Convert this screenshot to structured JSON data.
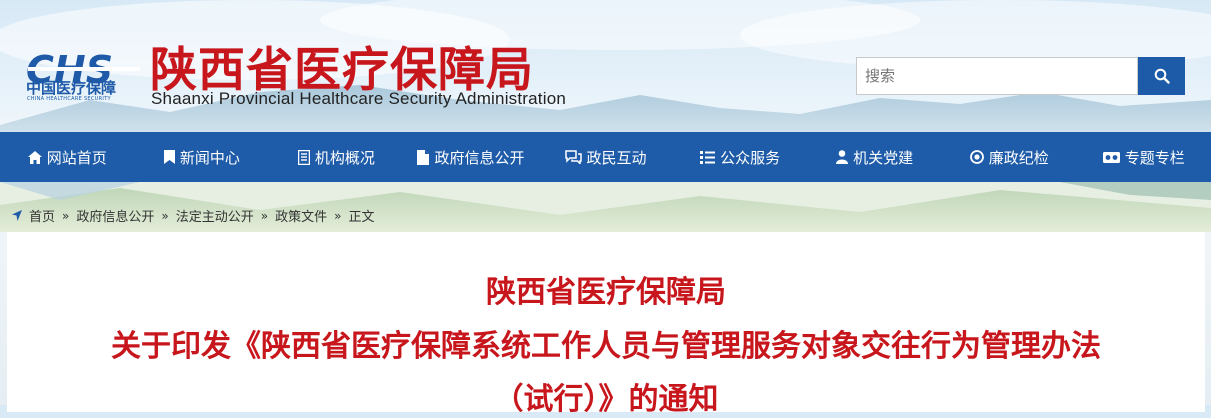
{
  "header": {
    "logo_cn": "中国医疗保障",
    "logo_en": "CHINA HEALTHCARE SECURITY",
    "site_title": "陕西省医疗保障局",
    "site_subtitle": "Shaanxi Provincial Healthcare Security Administration",
    "search_placeholder": "搜索"
  },
  "nav": {
    "items": [
      {
        "label": "网站首页",
        "icon": "home-icon"
      },
      {
        "label": "新闻中心",
        "icon": "bookmark-icon"
      },
      {
        "label": "机构概况",
        "icon": "book-icon"
      },
      {
        "label": "政府信息公开",
        "icon": "file-icon"
      },
      {
        "label": "政民互动",
        "icon": "chat-icon"
      },
      {
        "label": "公众服务",
        "icon": "list-icon"
      },
      {
        "label": "机关党建",
        "icon": "user-icon"
      },
      {
        "label": "廉政纪检",
        "icon": "target-icon"
      },
      {
        "label": "专题专栏",
        "icon": "columns-icon"
      }
    ]
  },
  "breadcrumb": {
    "items": [
      "首页",
      "政府信息公开",
      "法定主动公开",
      "政策文件",
      "正文"
    ],
    "separator": "»"
  },
  "article": {
    "title_line1": "陕西省医疗保障局",
    "title_line2": "关于印发《陕西省医疗保障系统工作人员与管理服务对象交往行为管理办法",
    "title_line3": "（试行）》的通知"
  },
  "colors": {
    "brand_red": "#c8161d",
    "brand_blue": "#1e5ba8"
  }
}
